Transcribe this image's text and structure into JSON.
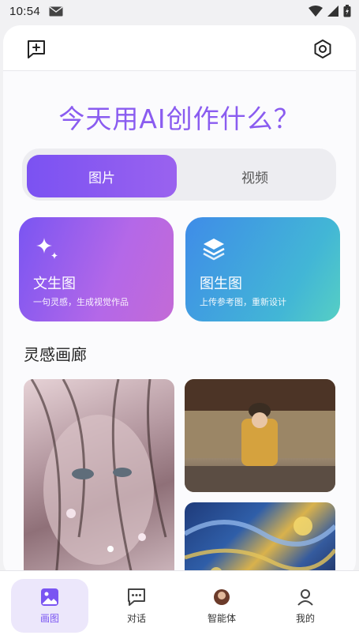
{
  "status_bar": {
    "time": "10:54"
  },
  "headline": "今天用AI创作什么？",
  "tabs": [
    {
      "label": "图片",
      "active": true
    },
    {
      "label": "视频",
      "active": false
    }
  ],
  "features": [
    {
      "title": "文生图",
      "subtitle": "一句灵感，生成视觉作品",
      "icon": "sparkle-icon"
    },
    {
      "title": "图生图",
      "subtitle": "上传参考图，重新设计",
      "icon": "layers-icon"
    }
  ],
  "gallery": {
    "title": "灵感画廊"
  },
  "bottom_nav": [
    {
      "label": "画图",
      "icon": "image-icon",
      "active": true
    },
    {
      "label": "对话",
      "icon": "chat-icon",
      "active": false
    },
    {
      "label": "智能体",
      "icon": "agent-icon",
      "active": false
    },
    {
      "label": "我的",
      "icon": "profile-icon",
      "active": false
    }
  ],
  "colors": {
    "accent": "#7b52f2",
    "teal": "#42b6d6",
    "headline": "#8a5cf0"
  }
}
